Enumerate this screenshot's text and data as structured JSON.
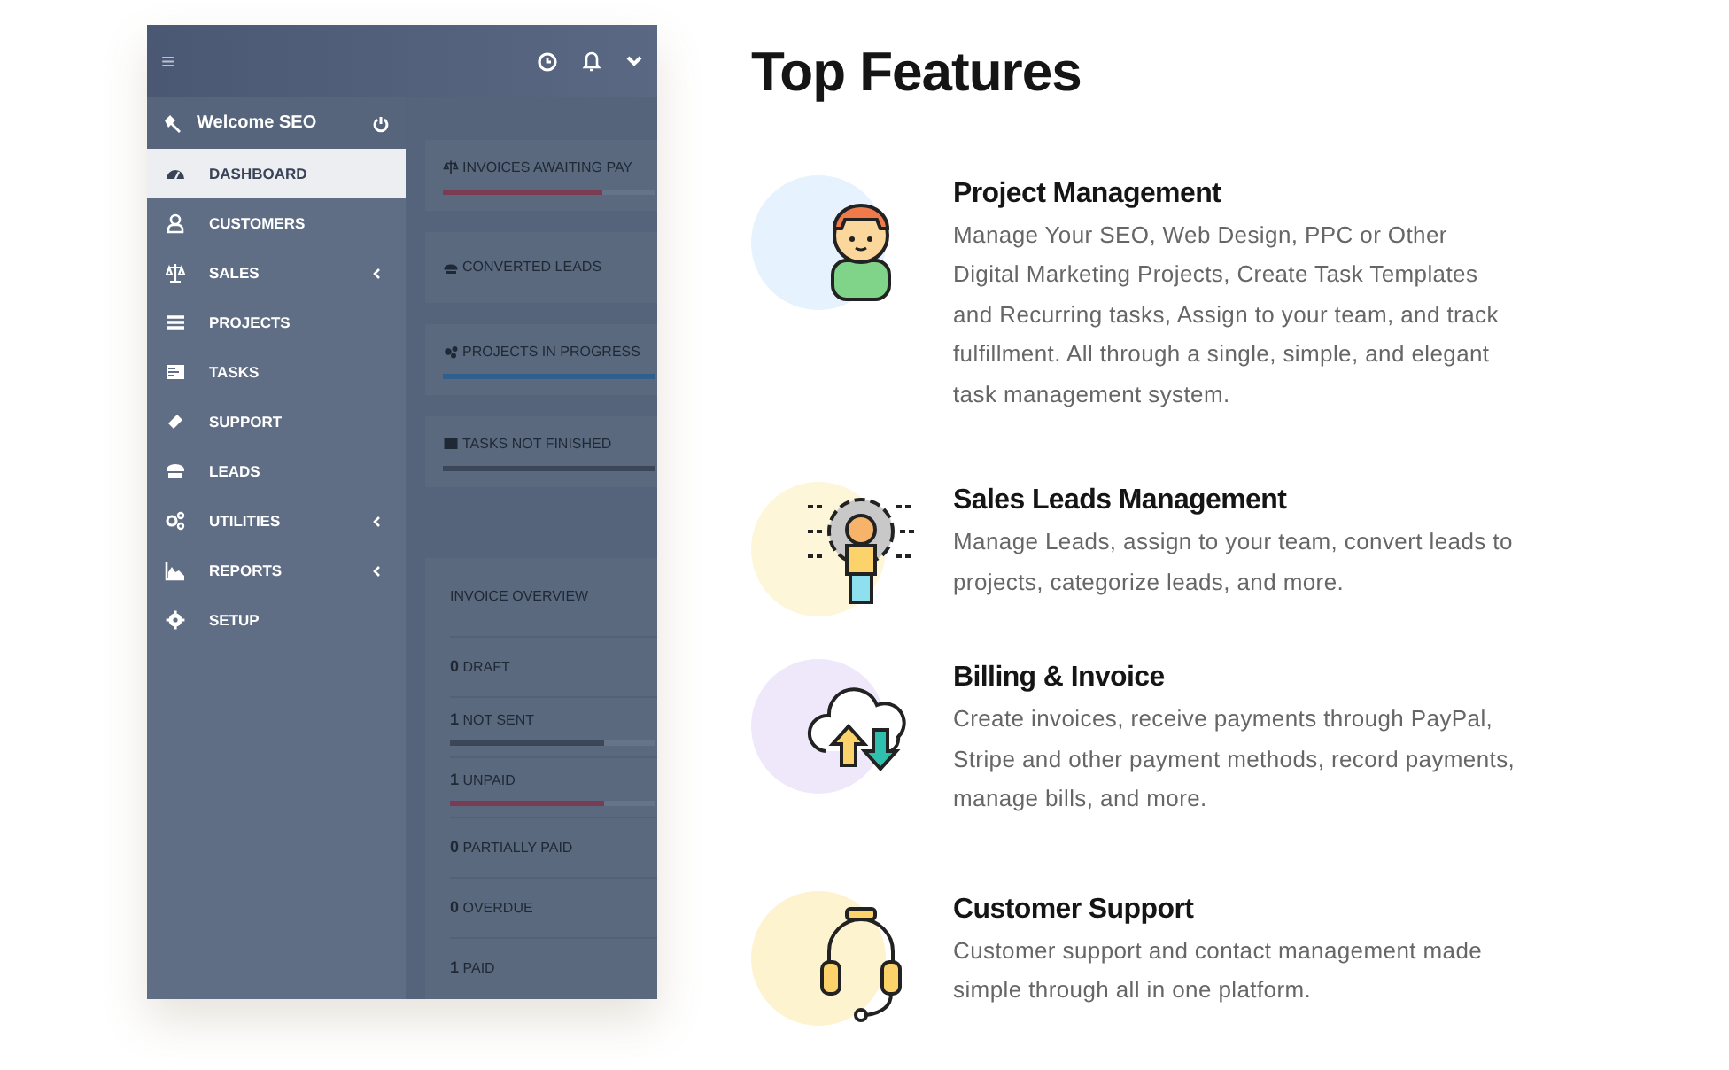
{
  "app_preview": {
    "header": {
      "menu_glyph": "≡"
    },
    "sidebar": {
      "welcome": "Welcome SEO",
      "items": [
        {
          "label": "DASHBOARD",
          "selected": true,
          "has_submenu": false
        },
        {
          "label": "CUSTOMERS",
          "selected": false,
          "has_submenu": false
        },
        {
          "label": "SALES",
          "selected": false,
          "has_submenu": true
        },
        {
          "label": "PROJECTS",
          "selected": false,
          "has_submenu": false
        },
        {
          "label": "TASKS",
          "selected": false,
          "has_submenu": false
        },
        {
          "label": "SUPPORT",
          "selected": false,
          "has_submenu": false
        },
        {
          "label": "LEADS",
          "selected": false,
          "has_submenu": false
        },
        {
          "label": "UTILITIES",
          "selected": false,
          "has_submenu": true
        },
        {
          "label": "REPORTS",
          "selected": false,
          "has_submenu": true
        },
        {
          "label": "SETUP",
          "selected": false,
          "has_submenu": false
        }
      ]
    },
    "widgets": [
      {
        "title": "INVOICES AWAITING PAY",
        "level": 0.75,
        "color": "#7a3b55"
      },
      {
        "title": "CONVERTED LEADS"
      },
      {
        "title": "PROJECTS IN PROGRESS",
        "level": 1,
        "color": "#2f5f8f"
      },
      {
        "title": "TASKS NOT FINISHED",
        "level": 1,
        "color": "#3b4658"
      }
    ],
    "invoice_overview": {
      "title": "INVOICE OVERVIEW",
      "rows": [
        {
          "count": "0",
          "label": "DRAFT"
        },
        {
          "count": "1",
          "label": "NOT SENT",
          "level": 0.75,
          "color": "#3b4658"
        },
        {
          "count": "1",
          "label": "UNPAID",
          "level": 0.75,
          "color": "#7a3b55"
        },
        {
          "count": "0",
          "label": "PARTIALLY PAID"
        },
        {
          "count": "0",
          "label": "OVERDUE"
        },
        {
          "count": "1",
          "label": "PAID"
        }
      ]
    }
  },
  "heading": "Top Features",
  "features": [
    {
      "title": "Project Management",
      "description": "Manage Your SEO, Web Design, PPC or Other Digital Marketing Projects, Create Task Templates and Recurring tasks, Assign to your team, and track fulfillment. All through a single, simple, and elegant task management system.",
      "color": "#e6f2fd"
    },
    {
      "title": "Sales Leads Management",
      "description": "Manage Leads, assign to your team, convert leads to projects, categorize leads, and more.",
      "color": "#fdf6d8"
    },
    {
      "title": "Billing & Invoice",
      "description": "Create invoices, receive payments through PayPal, Stripe and other payment methods, record payments, manage bills, and more.",
      "color": "#efe8fb"
    },
    {
      "title": "Customer Support",
      "description": "Customer support and contact management made simple through all in one platform.",
      "color": "#fdf3cf"
    }
  ]
}
